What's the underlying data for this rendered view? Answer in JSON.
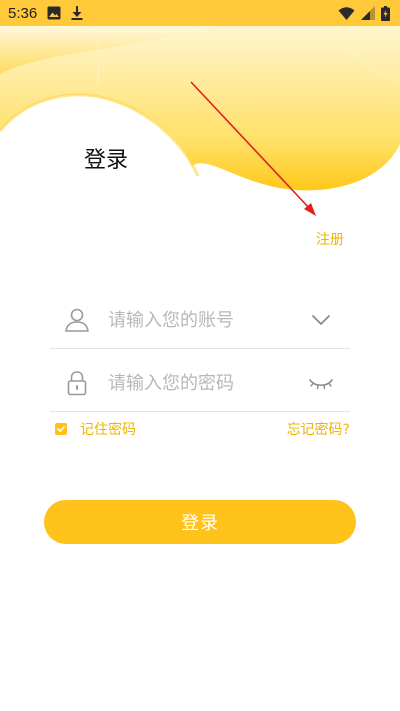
{
  "status_bar": {
    "time": "5:36",
    "icons": [
      "image-icon",
      "download-icon",
      "wifi-icon",
      "signal-icon",
      "battery-icon"
    ]
  },
  "header": {
    "title": "登录",
    "register_label": "注册"
  },
  "form": {
    "account_placeholder": "请输入您的账号",
    "password_placeholder": "请输入您的密码",
    "remember_label": "记住密码",
    "remember_checked": true,
    "forgot_label": "忘记密码?",
    "submit_label": "登录"
  },
  "colors": {
    "accent": "#ffc21a",
    "header_yellow": "#ffc93a",
    "link_text": "#f0b400",
    "annotation_arrow": "#e0201c"
  }
}
